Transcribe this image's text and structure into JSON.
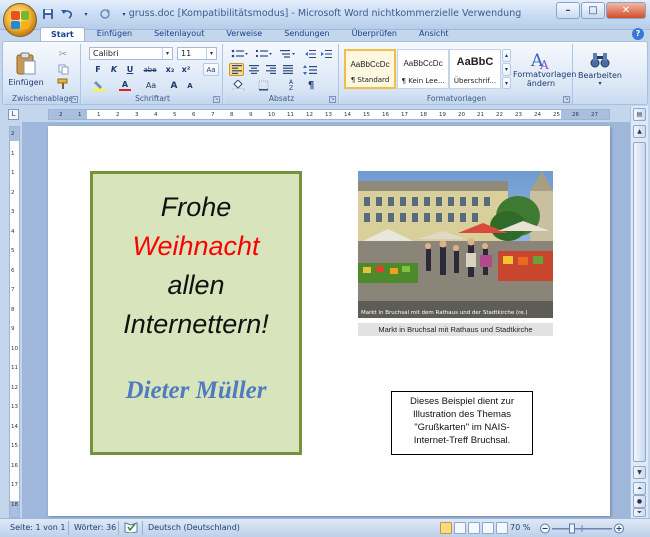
{
  "window": {
    "title": "gruss.doc [Kompatibilitätsmodus] - Microsoft Word nichtkommerzielle Verwendung",
    "controls": [
      "–",
      "□",
      "✕"
    ]
  },
  "tabs": [
    {
      "label": "Start",
      "active": true
    },
    {
      "label": "Einfügen",
      "active": false
    },
    {
      "label": "Seitenlayout",
      "active": false
    },
    {
      "label": "Verweise",
      "active": false
    },
    {
      "label": "Sendungen",
      "active": false
    },
    {
      "label": "Überprüfen",
      "active": false
    },
    {
      "label": "Ansicht",
      "active": false
    }
  ],
  "help": "?",
  "ribbon": {
    "clipboard": {
      "label": "Zwischenablage",
      "paste_label": "Einfügen"
    },
    "font": {
      "label": "Schriftart",
      "font_name": "Calibri",
      "font_size": "11",
      "bold": "F",
      "italic": "K",
      "underline": "U",
      "strike": "abe",
      "subscript": "x₂",
      "superscript": "x²",
      "grow": "A",
      "shrink": "A",
      "case": "Aa",
      "clear": "Aa"
    },
    "paragraph": {
      "label": "Absatz",
      "pilcrow": "¶"
    },
    "styles": {
      "label": "Formatvorlagen",
      "items": [
        {
          "sample": "AaBbCcDc",
          "name": "¶ Standard",
          "selected": true
        },
        {
          "sample": "AaBbCcDc",
          "name": "¶ Kein Lee...",
          "selected": false
        },
        {
          "sample": "AaBbC",
          "name": "Überschrif...",
          "selected": false
        }
      ],
      "change_label": "Formatvorlagen ändern"
    },
    "editing": {
      "label": "Bearbeiten"
    }
  },
  "ruler": {
    "corner": "L",
    "h_ticks": [
      "2",
      "1",
      "1",
      "2",
      "3",
      "4",
      "5",
      "6",
      "7",
      "8",
      "9",
      "10",
      "11",
      "12",
      "13",
      "14",
      "15",
      "16",
      "17",
      "18",
      "19",
      "20",
      "21",
      "22",
      "23",
      "24",
      "25",
      "26",
      "27"
    ],
    "v_ticks": [
      "2",
      "1",
      "1",
      "2",
      "3",
      "4",
      "5",
      "6",
      "7",
      "8",
      "9",
      "10",
      "11",
      "12",
      "13",
      "14",
      "15",
      "16",
      "17",
      "18"
    ]
  },
  "document": {
    "greeting_lines": [
      "Frohe",
      "Weihnacht",
      "allen",
      "Internettern!"
    ],
    "signature": "Dieter Müller",
    "photo_overlay": "Markt in Bruchsal mit dem Rathaus und der Stadtkirche (re.)",
    "photo_caption": "Markt in Bruchsal mit Rathaus und Stadtkirche",
    "note_lines": [
      "Dieses Beispiel dient zur",
      "Illustration des Themas",
      "\"Grußkarten\" im NAIS-",
      "Internet-Treff Bruchsal."
    ]
  },
  "status": {
    "page": "Seite: 1 von 1",
    "words": "Wörter: 36",
    "language": "Deutsch (Deutschland)",
    "zoom": "70 %",
    "zoom_level": 0.7
  },
  "colors": {
    "greeting_fill": "#d8e4bc",
    "greeting_border": "#76923c",
    "red_word": "#ff0000",
    "signature": "#4f7cc0"
  }
}
